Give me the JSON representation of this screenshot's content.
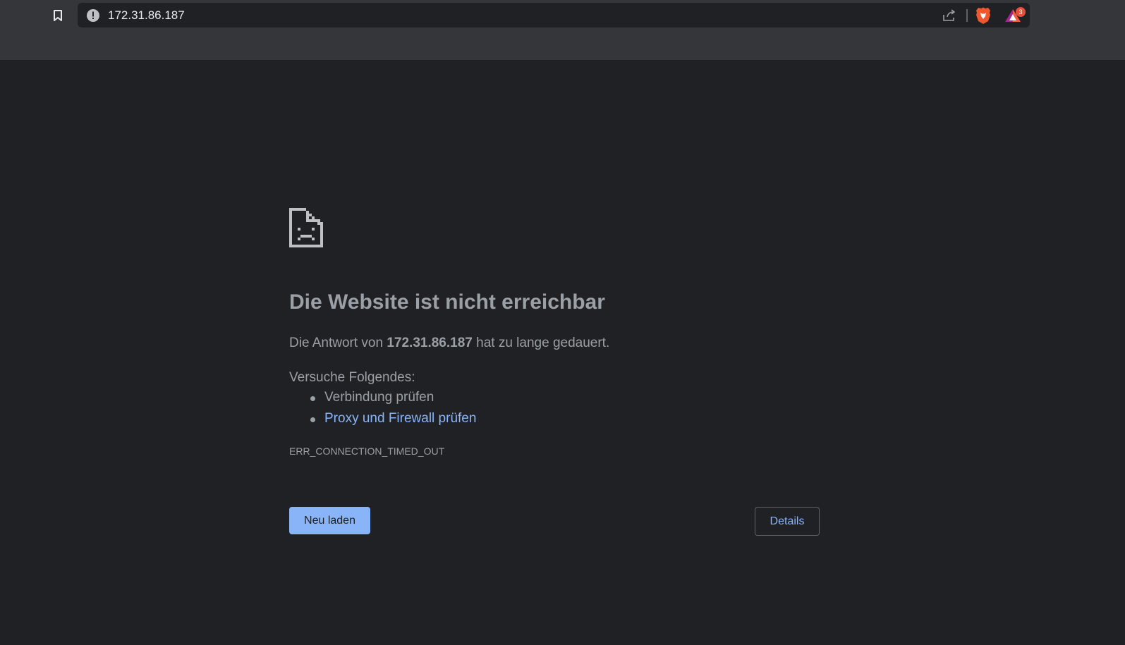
{
  "address_bar": {
    "url": "172.31.86.187",
    "info_icon": "info-warning-icon",
    "bookmark_icon": "bookmark-icon",
    "share_icon": "share-icon",
    "brave_icon": "brave-shields-icon",
    "rewards_icon": "brave-rewards-icon",
    "rewards_badge": "3"
  },
  "error_page": {
    "icon": "sad-page-icon",
    "title": "Die Website ist nicht erreichbar",
    "message_prefix": "Die Antwort von ",
    "message_host": "172.31.86.187",
    "message_suffix": " hat zu lange gedauert.",
    "suggestions_heading": "Versuche Folgendes:",
    "suggestions": [
      "Verbindung prüfen",
      "Proxy und Firewall prüfen"
    ],
    "error_code": "ERR_CONNECTION_TIMED_OUT",
    "reload_label": "Neu laden",
    "details_label": "Details"
  },
  "colors": {
    "page_background": "#202124",
    "chrome_background": "#35363a",
    "text": "#9aa0a6",
    "link": "#8ab4f8",
    "primary_button": "#8ab4f8"
  }
}
